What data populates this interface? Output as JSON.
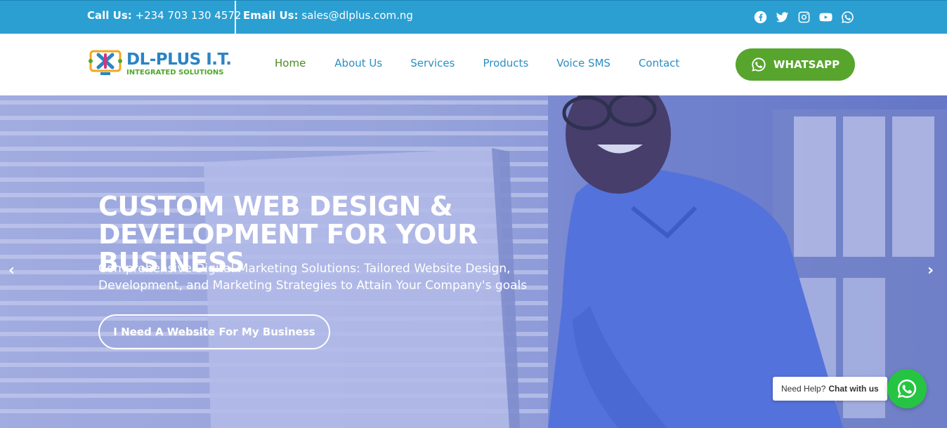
{
  "topbar": {
    "call_label": "Call Us:",
    "call_value": "+234 703 130 4572",
    "email_label": "Email Us:",
    "email_value": "sales@dlplus.com.ng",
    "social_icons": [
      "facebook-icon",
      "twitter-icon",
      "instagram-icon",
      "youtube-icon",
      "whatsapp-icon"
    ],
    "background_color": "#2b9fd2"
  },
  "logo": {
    "name": "DL-PLUS I.T.",
    "tagline": "INTEGRATED SOLUTIONS"
  },
  "nav": {
    "items": [
      "Home",
      "About Us",
      "Services",
      "Products",
      "Voice SMS",
      "Contact"
    ],
    "active": "Home",
    "link_color": "#2a8fc6",
    "active_color": "#4d8a22"
  },
  "whatsapp_button": {
    "label": "WHATSAPP",
    "icon": "whatsapp-icon",
    "color": "#58a52e"
  },
  "hero": {
    "title_line1": "CUSTOM WEB DESIGN &",
    "title_line2": "DEVELOPMENT FOR YOUR BUSINESS",
    "subtitle_line1": "Comprehensive Digital Marketing Solutions: Tailored Website Design,",
    "subtitle_line2": "Development, and Marketing Strategies to Attain Your Company's goals",
    "cta_label": "I Need A Website For My Business",
    "prev_arrow": "‹",
    "next_arrow": "›"
  },
  "chat_widget": {
    "prompt": "Need Help?",
    "action": "Chat with us",
    "icon": "whatsapp-icon",
    "color": "#26c443"
  }
}
